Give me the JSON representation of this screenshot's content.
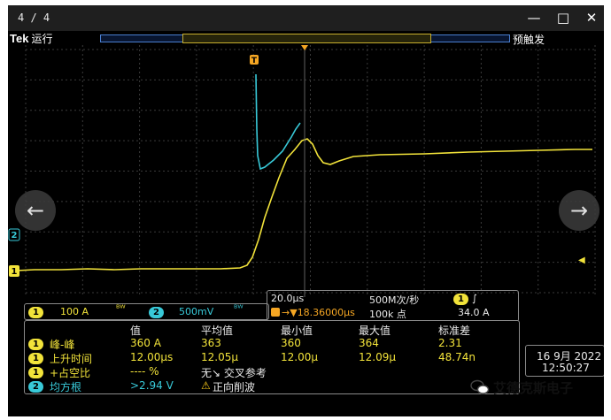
{
  "window": {
    "page_indicator": "4 / 4",
    "minimize_icon": "minimize-icon",
    "maximize_icon": "maximize-icon",
    "close_icon": "close-icon"
  },
  "status": {
    "brand": "Tek",
    "run_state": "运行",
    "trigger_mode": "预触发"
  },
  "markers": {
    "trigger": "T",
    "ch2_marker": "2",
    "ch1_marker": "1",
    "trigger_level_arrow": "◀"
  },
  "colors": {
    "ch1": "#f2e33a",
    "ch2": "#38c9d8",
    "trigger": "#f5a623",
    "grid": "#3a3a3a"
  },
  "channels": [
    {
      "badge": "1",
      "scale": "100 A",
      "bw": "ᴮᵂ"
    },
    {
      "badge": "2",
      "scale": "500mV",
      "bw": "ᴮᵂ"
    }
  ],
  "horizontal": {
    "timebase": "20.0μs",
    "sample_rate": "500M次/秒",
    "trigger_badge": "1",
    "trigger_slope": "∫",
    "trigger_delay": "18.36000μs",
    "record_length": "100k 点",
    "trigger_level": "34.0 A"
  },
  "measurements": {
    "headers": [
      "值",
      "平均值",
      "最小值",
      "最大值",
      "标准差"
    ],
    "rows": [
      {
        "badge": "1",
        "name": "峰-峰",
        "value": "360 A",
        "mean": "363",
        "min": "360",
        "max": "364",
        "std": "2.31"
      },
      {
        "badge": "1",
        "name": "上升时间",
        "value": "12.00μs",
        "mean": "12.05μ",
        "min": "12.00μ",
        "max": "12.09μ",
        "std": "48.74n"
      },
      {
        "badge": "1",
        "name": "+占空比",
        "value": "---- %",
        "note": "无↘ 交叉参考"
      },
      {
        "badge": "2",
        "name": "均方根",
        "value": ">2.94 V",
        "warn": "⚠",
        "note": "正向削波"
      }
    ]
  },
  "datetime": {
    "date": "16 9月 2022",
    "time": "12:50:27"
  },
  "nav": {
    "prev": "←",
    "next": "→"
  },
  "watermark": {
    "text": "艾德克斯电子"
  }
}
